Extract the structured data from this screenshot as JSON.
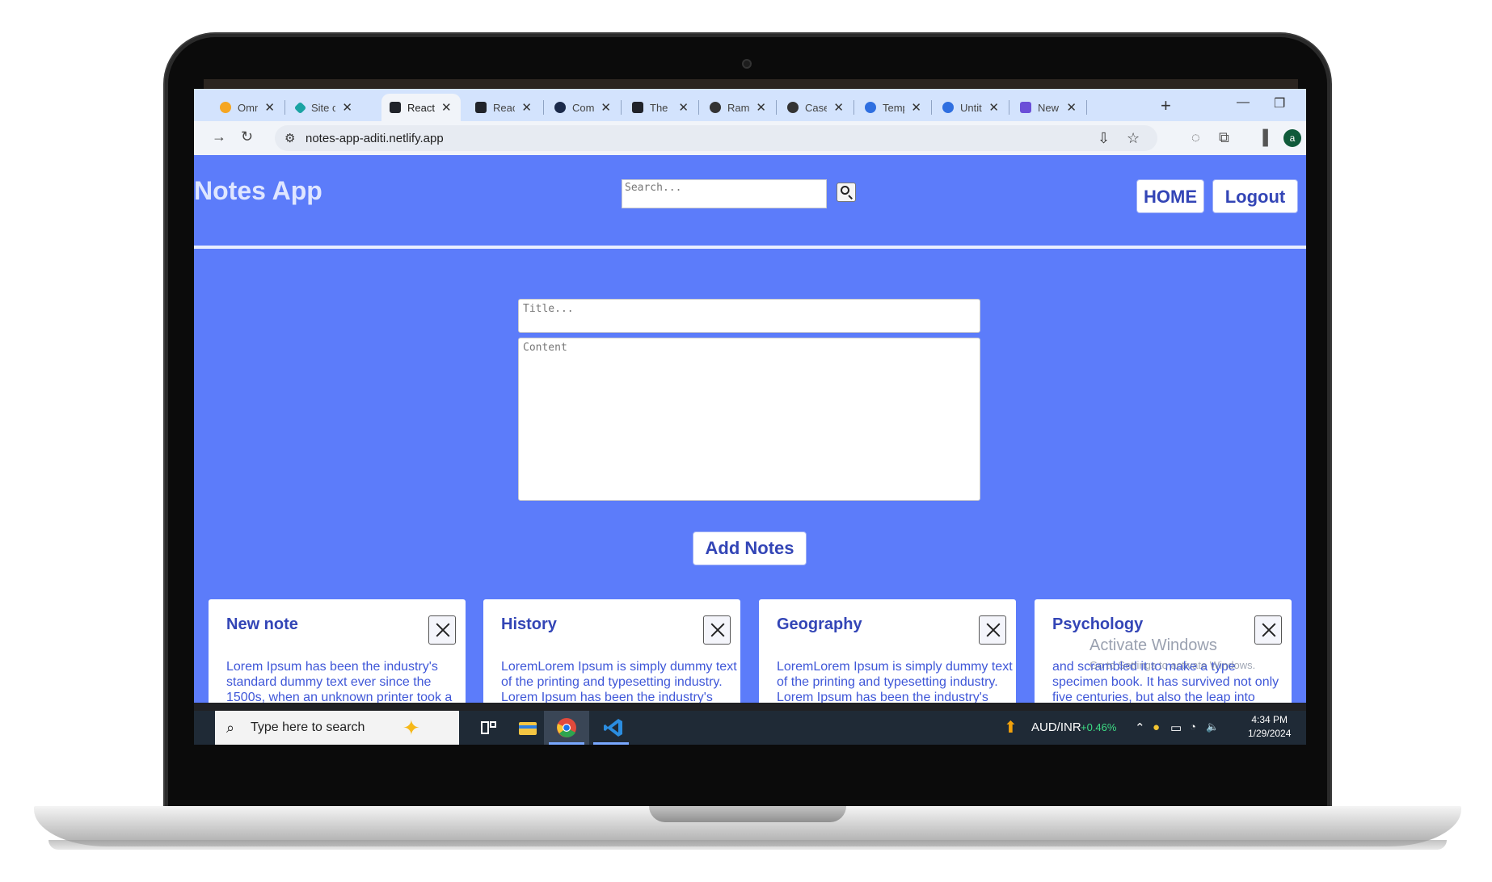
{
  "browser": {
    "tabs": [
      {
        "title": "Omni",
        "icon_color": "#f5a623",
        "icon": "infinity-icon"
      },
      {
        "title": "Site c",
        "icon_color": "#1aa3a3",
        "icon": "diamond-icon"
      },
      {
        "title": "React",
        "icon_color": "#20232a",
        "icon": "react-icon",
        "active": true
      },
      {
        "title": "React",
        "icon_color": "#20232a",
        "icon": "react-icon"
      },
      {
        "title": "Comp",
        "icon_color": "#1b2a4a",
        "icon": "component-icon"
      },
      {
        "title": "The F",
        "icon_color": "#20232a",
        "icon": "react-icon"
      },
      {
        "title": "Ram",
        "icon_color": "#333333",
        "icon": "avatar-icon"
      },
      {
        "title": "Case",
        "icon_color": "#333333",
        "icon": "avatar-icon"
      },
      {
        "title": "Temp",
        "icon_color": "#2f6fe0",
        "icon": "canva-icon"
      },
      {
        "title": "Untit",
        "icon_color": "#2f6fe0",
        "icon": "canva-icon"
      },
      {
        "title": "New",
        "icon_color": "#6b4fd8",
        "icon": "heart-chat-icon"
      }
    ],
    "url": "notes-app-aditi.netlify.app",
    "profile_initial": "a"
  },
  "app": {
    "title": "Notes App",
    "search_placeholder": "Search...",
    "home_label": "HOME",
    "logout_label": "Logout",
    "title_placeholder": "Title...",
    "content_placeholder": "Content",
    "add_label": "Add Notes"
  },
  "notes": [
    {
      "title": "New note",
      "text": "Lorem Ipsum has been the industry's standard dummy text ever since the 1500s, when an unknown printer took a galley of type and scrambled it to make a type"
    },
    {
      "title": "History",
      "text": "LoremLorem Ipsum is simply dummy text of the printing and typesetting industry. Lorem Ipsum has been the industry's standard dummy text"
    },
    {
      "title": "Geography",
      "text": "LoremLorem Ipsum is simply dummy text of the printing and typesetting industry. Lorem Ipsum has been the industry's standard dummy text"
    },
    {
      "title": "Psychology",
      "text": "and scrambled it to make a type specimen book. It has survived not only five centuries, but also the leap into electronic typesetting, remaining"
    }
  ],
  "watermark": {
    "line1": "Activate Windows",
    "line2": "Go to Settings to activate Windows."
  },
  "taskbar": {
    "search_text": "Type here to search",
    "ticker": "AUD/INR",
    "ticker_change": "+0.46%",
    "time": "4:34 PM",
    "date": "1/29/2024"
  },
  "colors": {
    "page_bg": "#5c7cfa",
    "accent_text": "#3345b6",
    "ticker_up": "#3ddc84"
  }
}
